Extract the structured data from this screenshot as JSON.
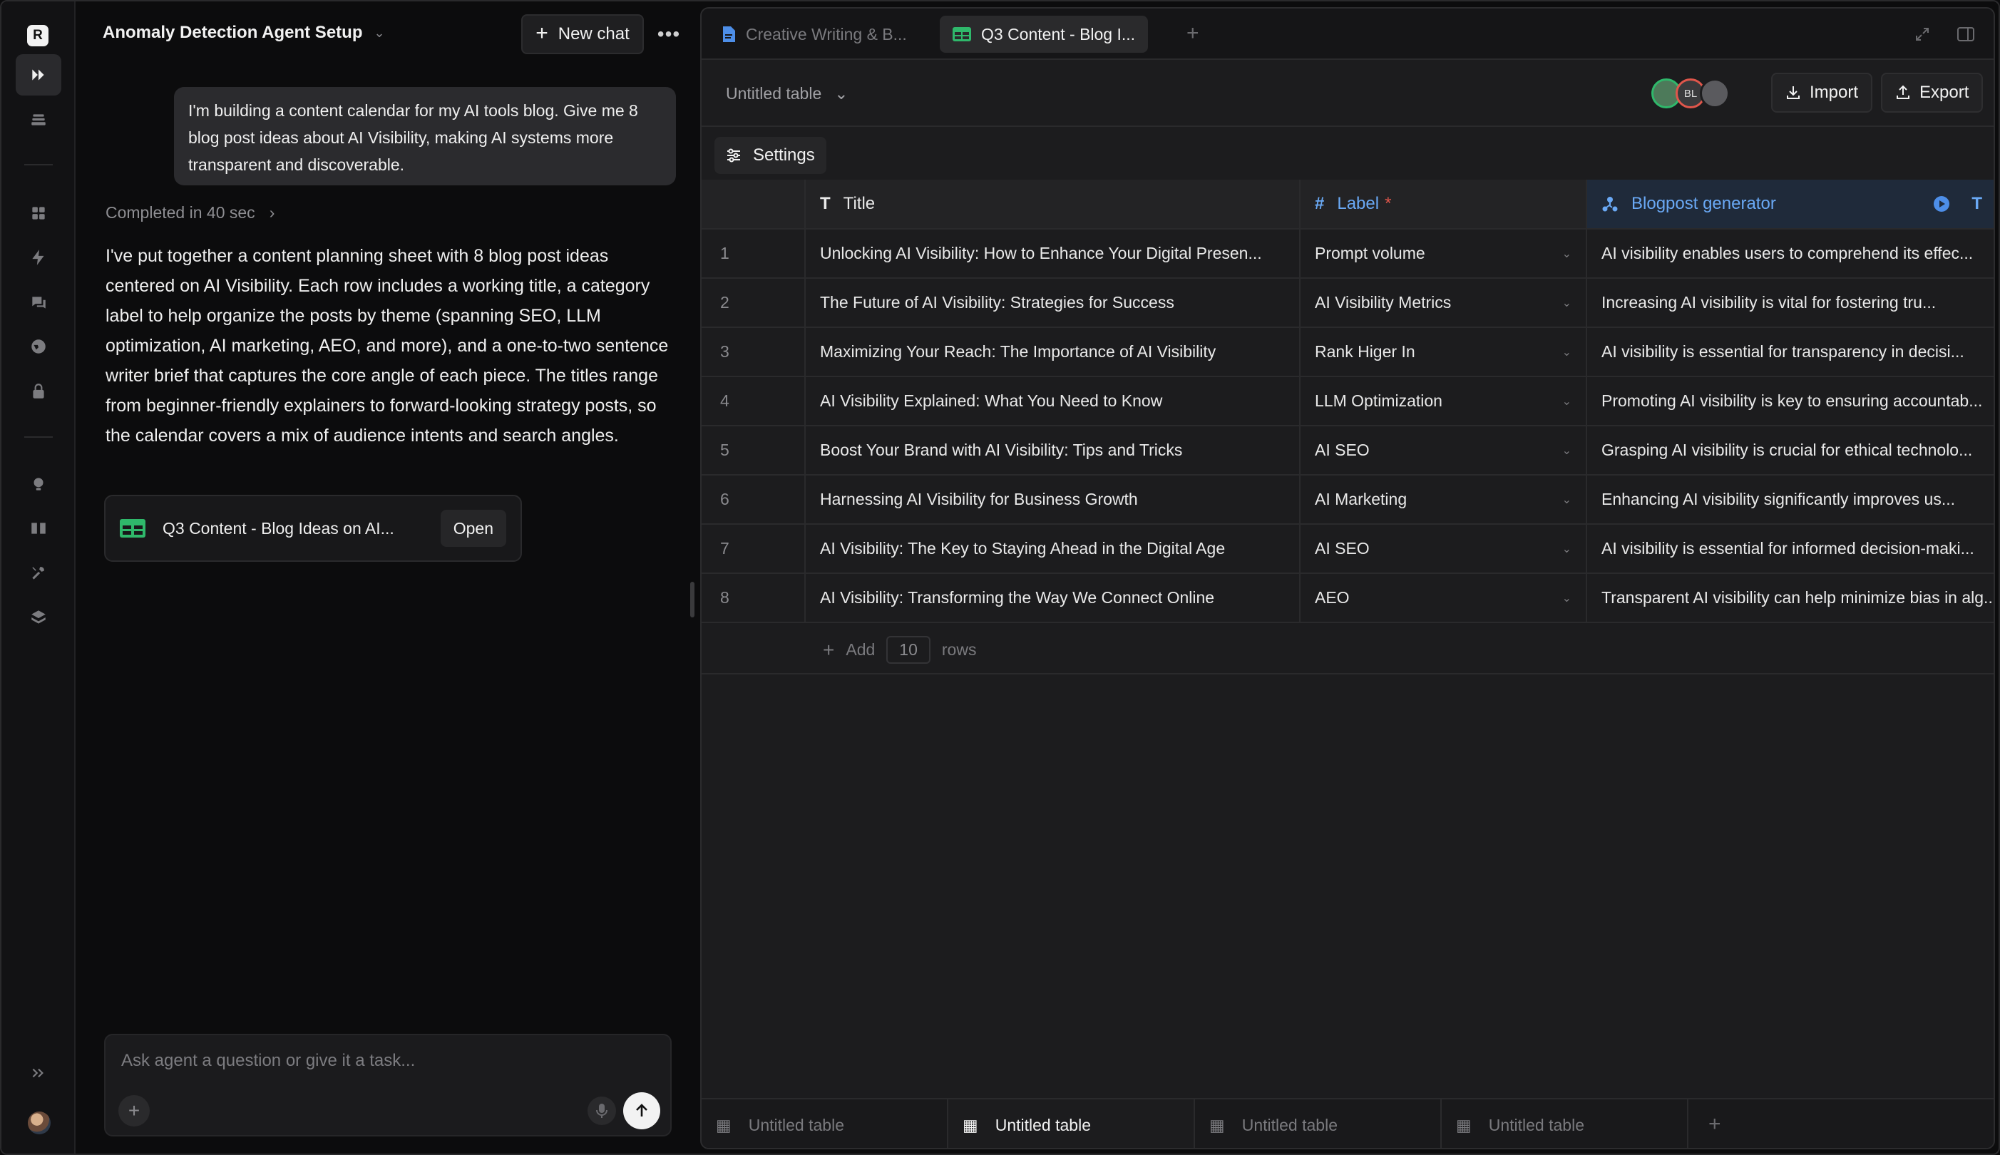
{
  "rail": {
    "items": [
      "logo",
      "agents-icon",
      "inbox-icon",
      "apps-icon",
      "bolt-icon",
      "chat-icon",
      "globe-icon",
      "lock-icon",
      "bulb-icon",
      "book-icon",
      "tools-icon",
      "layers-icon"
    ],
    "logo_letter": "R"
  },
  "chat": {
    "title": "Anomaly Detection Agent Setup",
    "new_chat_label": "New chat",
    "user_message": "I'm building a content calendar for my AI tools blog. Give me 8 blog post ideas about AI Visibility, making AI systems more transparent and discoverable.",
    "completed_label": "Completed in 40 sec",
    "answer": "I've put together a content planning sheet with 8 blog post ideas centered on AI Visibility. Each row includes a working title, a category label to help organize the posts by theme (spanning SEO, LLM optimization, AI marketing, AEO, and more), and a one-to-two sentence writer brief that captures the core angle of each piece. The titles range from beginner-friendly explainers to forward-looking strategy posts, so the calendar covers a mix of audience intents and search angles.",
    "artifact": {
      "title": "Q3 Content - Blog Ideas on AI...",
      "open_label": "Open"
    },
    "composer_placeholder": "Ask agent a question or give it a task..."
  },
  "workspace": {
    "tabs": [
      {
        "label": "Creative Writing & B...",
        "active": false
      },
      {
        "label": "Q3 Content - Blog I...",
        "active": true
      }
    ],
    "table_name": "Untitled table",
    "avatar_initials": "BL",
    "import_label": "Import",
    "export_label": "Export",
    "settings_label": "Settings",
    "columns": {
      "title": "Title",
      "label": "Label",
      "label_required": "*",
      "generator": "Blogpost generator"
    },
    "rows": [
      {
        "n": "1",
        "title": "Unlocking AI Visibility: How to Enhance Your Digital Presen...",
        "label": "Prompt volume",
        "gen": "AI visibility enables users to comprehend its effec..."
      },
      {
        "n": "2",
        "title": "The Future of AI Visibility: Strategies for Success",
        "label": "AI Visibility Metrics",
        "gen": "Increasing AI visibility is vital for fostering tru..."
      },
      {
        "n": "3",
        "title": "Maximizing Your Reach: The Importance of AI Visibility",
        "label": "Rank Higer In",
        "gen": "AI visibility is essential for transparency in decisi..."
      },
      {
        "n": "4",
        "title": "AI Visibility Explained: What You Need to Know",
        "label": "LLM Optimization",
        "gen": "Promoting AI visibility is key to ensuring accountab..."
      },
      {
        "n": "5",
        "title": "Boost Your Brand with AI Visibility: Tips and Tricks",
        "label": "AI SEO",
        "gen": "Grasping AI visibility is crucial for ethical technolo..."
      },
      {
        "n": "6",
        "title": "Harnessing AI Visibility for Business Growth",
        "label": "AI Marketing",
        "gen": "Enhancing AI visibility significantly improves us..."
      },
      {
        "n": "7",
        "title": "AI Visibility: The Key to Staying Ahead in the Digital Age",
        "label": "AI SEO",
        "gen": "AI visibility is essential for informed decision-maki..."
      },
      {
        "n": "8",
        "title": "AI Visibility: Transforming the Way We Connect Online",
        "label": "AEO",
        "gen": "Transparent AI visibility can help minimize bias in alg..."
      }
    ],
    "add_rows": {
      "add": "Add",
      "count": "10",
      "rows": "rows"
    },
    "sheet_tabs": [
      {
        "label": "Untitled table",
        "active": false
      },
      {
        "label": "Untitled table",
        "active": true
      },
      {
        "label": "Untitled table",
        "active": false
      },
      {
        "label": "Untitled table",
        "active": false
      }
    ]
  },
  "colors": {
    "accent_blue": "#6aa9f5",
    "sheet_green": "#2fb86b",
    "required_red": "#e0564b"
  }
}
